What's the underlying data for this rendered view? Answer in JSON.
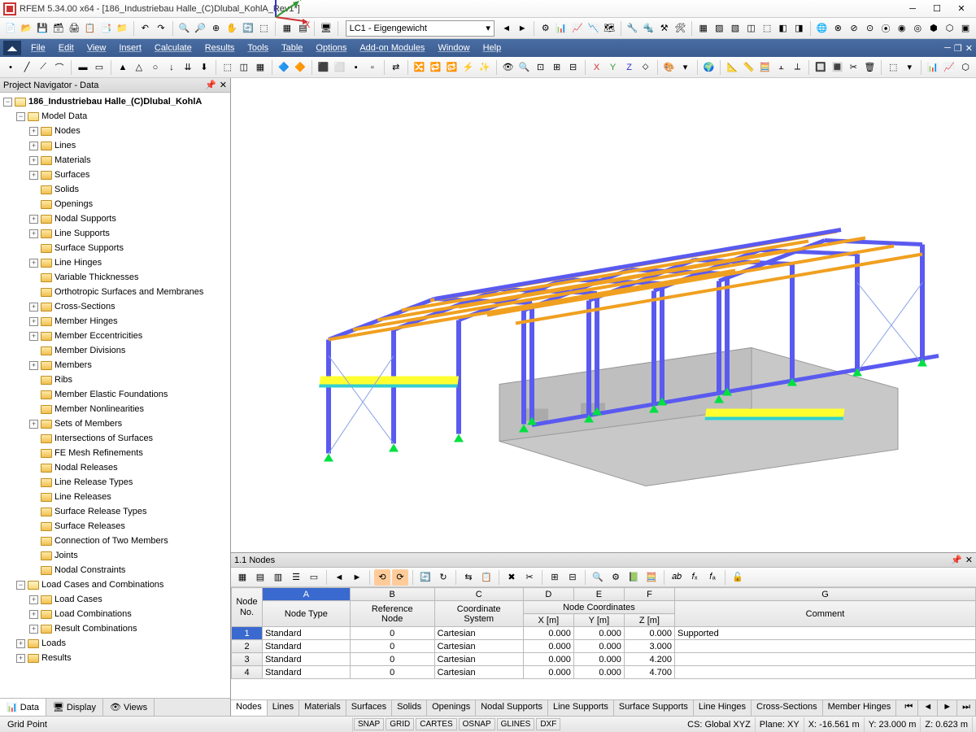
{
  "window": {
    "title": "RFEM 5.34.00 x64 - [186_Industriebau Halle_(C)Dlubal_KohlA_Rev1*]"
  },
  "loadcase": "LC1 - Eigengewicht",
  "menu": [
    "File",
    "Edit",
    "View",
    "Insert",
    "Calculate",
    "Results",
    "Tools",
    "Table",
    "Options",
    "Add-on Modules",
    "Window",
    "Help"
  ],
  "navigator": {
    "title": "Project Navigator - Data",
    "root": "186_Industriebau Halle_(C)Dlubal_KohlA",
    "modelData": "Model Data",
    "items": [
      "Nodes",
      "Lines",
      "Materials",
      "Surfaces",
      "Solids",
      "Openings",
      "Nodal Supports",
      "Line Supports",
      "Surface Supports",
      "Line Hinges",
      "Variable Thicknesses",
      "Orthotropic Surfaces and Membranes",
      "Cross-Sections",
      "Member Hinges",
      "Member Eccentricities",
      "Member Divisions",
      "Members",
      "Ribs",
      "Member Elastic Foundations",
      "Member Nonlinearities",
      "Sets of Members",
      "Intersections of Surfaces",
      "FE Mesh Refinements",
      "Nodal Releases",
      "Line Release Types",
      "Line Releases",
      "Surface Release Types",
      "Surface Releases",
      "Connection of Two Members",
      "Joints",
      "Nodal Constraints"
    ],
    "loadCasesComb": "Load Cases and Combinations",
    "lcItems": [
      "Load Cases",
      "Load Combinations",
      "Result Combinations"
    ],
    "extra": [
      "Loads",
      "Results"
    ],
    "tabs": [
      "Data",
      "Display",
      "Views"
    ]
  },
  "table": {
    "title": "1.1 Nodes",
    "colLetters": [
      "A",
      "B",
      "C",
      "D",
      "E",
      "F",
      "G"
    ],
    "headerRow1": {
      "nodeNo": "Node\nNo.",
      "nodeType": "Node Type",
      "refNode": "Reference\nNode",
      "coordSys": "Coordinate\nSystem",
      "nodeCoords": "Node Coordinates",
      "comment": "Comment"
    },
    "headerRow2": {
      "x": "X [m]",
      "y": "Y [m]",
      "z": "Z [m]"
    },
    "rows": [
      {
        "no": 1,
        "type": "Standard",
        "ref": 0,
        "sys": "Cartesian",
        "x": "0.000",
        "y": "0.000",
        "z": "0.000",
        "comment": "Supported"
      },
      {
        "no": 2,
        "type": "Standard",
        "ref": 0,
        "sys": "Cartesian",
        "x": "0.000",
        "y": "0.000",
        "z": "3.000",
        "comment": ""
      },
      {
        "no": 3,
        "type": "Standard",
        "ref": 0,
        "sys": "Cartesian",
        "x": "0.000",
        "y": "0.000",
        "z": "4.200",
        "comment": ""
      },
      {
        "no": 4,
        "type": "Standard",
        "ref": 0,
        "sys": "Cartesian",
        "x": "0.000",
        "y": "0.000",
        "z": "4.700",
        "comment": ""
      }
    ],
    "tabs": [
      "Nodes",
      "Lines",
      "Materials",
      "Surfaces",
      "Solids",
      "Openings",
      "Nodal Supports",
      "Line Supports",
      "Surface Supports",
      "Line Hinges",
      "Cross-Sections",
      "Member Hinges"
    ]
  },
  "status": {
    "left": "Grid Point",
    "snaps": [
      "SNAP",
      "GRID",
      "CARTES",
      "OSNAP",
      "GLINES",
      "DXF"
    ],
    "cs": "CS: Global XYZ",
    "plane": "Plane: XY",
    "x": "X: -16.561 m",
    "y": "Y:  23.000 m",
    "z": "Z:  0.623 m"
  },
  "axes": {
    "x": "X",
    "y": "Y",
    "z": "Z"
  }
}
